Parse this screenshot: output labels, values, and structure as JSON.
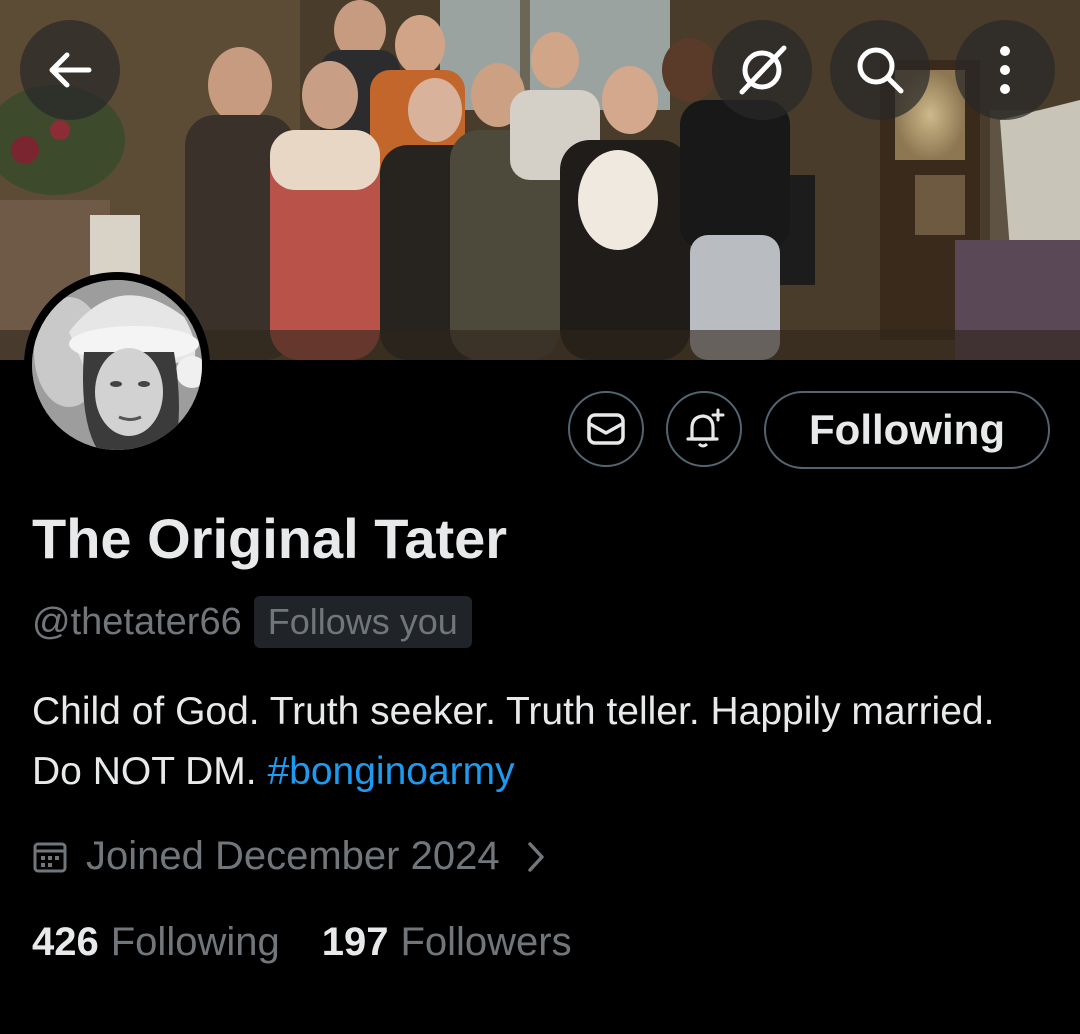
{
  "header": {
    "banner_image": "family-group-photo-in-living-room",
    "back_icon": "arrow-left-icon",
    "grok_icon": "grok-icon",
    "search_icon": "search-icon",
    "more_icon": "more-vertical-icon"
  },
  "profile": {
    "avatar_image": "woman-with-santa-hat-black-and-white",
    "display_name": "The Original Tater",
    "handle": "@thetater66",
    "follows_you": "Follows you",
    "bio_text": "Child of God. Truth seeker. Truth teller. Happily married. Do NOT DM.",
    "bio_hashtag": "#bonginoarmy",
    "joined": "Joined December 2024",
    "following_count": "426",
    "following_label": "Following",
    "followers_count": "197",
    "followers_label": "Followers"
  },
  "actions": {
    "message_icon": "envelope-icon",
    "notify_icon": "bell-plus-icon",
    "follow_button_label": "Following"
  },
  "colors": {
    "background": "#000000",
    "primary_text": "#e7e9ea",
    "secondary_text": "#71767b",
    "link": "#1d9bf0",
    "border": "#536471"
  }
}
